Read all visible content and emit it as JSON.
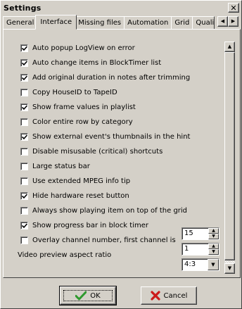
{
  "window": {
    "title": "Settings",
    "close_glyph": "✕"
  },
  "tabs": [
    {
      "label": "General",
      "active": false
    },
    {
      "label": "Interface",
      "active": true
    },
    {
      "label": "Missing files",
      "active": false
    },
    {
      "label": "Automation",
      "active": false
    },
    {
      "label": "Grid",
      "active": false
    },
    {
      "label": "Quali",
      "active": false
    }
  ],
  "options": [
    {
      "label": "Auto popup LogView on error",
      "checked": true
    },
    {
      "label": "Auto change items in BlockTimer list",
      "checked": true
    },
    {
      "label": "Add original duration in notes after trimming",
      "checked": true
    },
    {
      "label": "Copy HouseID to TapeID",
      "checked": false
    },
    {
      "label": "Show frame values in playlist",
      "checked": true
    },
    {
      "label": "Color entire row by category",
      "checked": false
    },
    {
      "label": "Show external event's thumbnails in the hint",
      "checked": true
    },
    {
      "label": "Disable misusable (critical) shortcuts",
      "checked": false
    },
    {
      "label": "Large status bar",
      "checked": false
    },
    {
      "label": "Use extended MPEG info tip",
      "checked": false
    },
    {
      "label": "Hide hardware reset button",
      "checked": true
    },
    {
      "label": "Always show playing item on top of the grid",
      "checked": false
    },
    {
      "label": "Show progress bar in block timer",
      "checked": true
    },
    {
      "label": "Overlay channel number, first channel is",
      "checked": false
    }
  ],
  "progress_spin": {
    "value": "15"
  },
  "channel_spin": {
    "value": "1"
  },
  "aspect": {
    "label": "Video preview aspect ratio",
    "value": "4:3"
  },
  "buttons": {
    "ok_label": "OK",
    "cancel_label": "Cancel"
  },
  "colors": {
    "face": "#d4d0c8",
    "ok_icon": "#2e9a2e",
    "cancel_icon": "#cc1a1a"
  },
  "icons": {
    "ok": "checkmark-icon",
    "cancel": "x-icon"
  }
}
